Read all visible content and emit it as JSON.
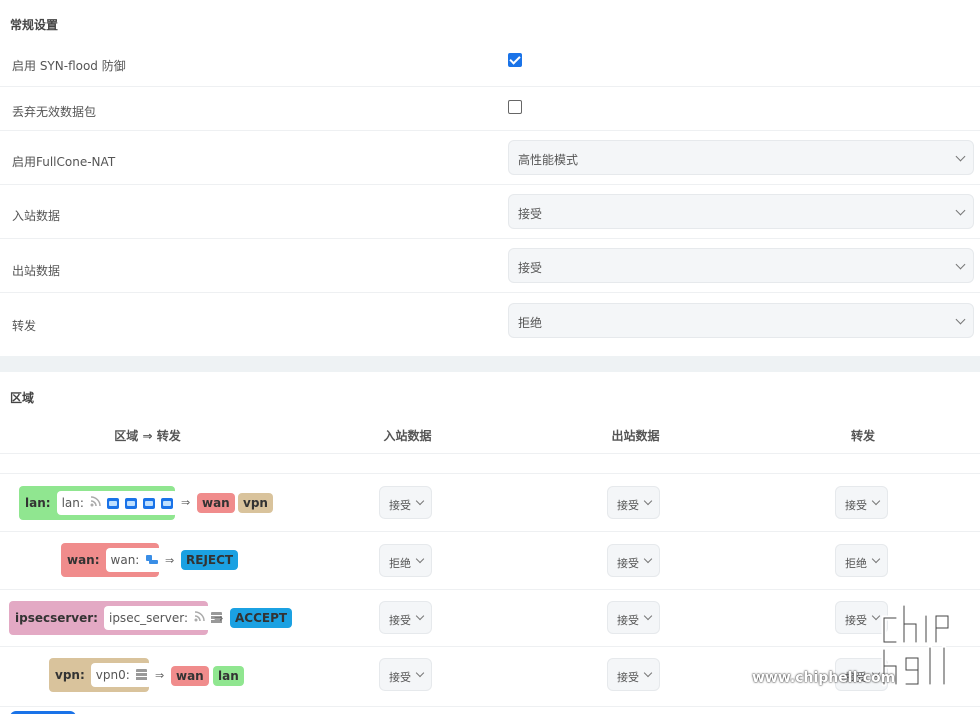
{
  "general": {
    "title": "常规设置",
    "rows": [
      {
        "label": "启用 SYN-flood 防御",
        "type": "checkbox",
        "checked": true
      },
      {
        "label": "丢弃无效数据包",
        "type": "checkbox",
        "checked": false
      },
      {
        "label": "启用FullCone-NAT",
        "type": "select",
        "value": "高性能模式"
      },
      {
        "label": "入站数据",
        "type": "select",
        "value": "接受"
      },
      {
        "label": "出站数据",
        "type": "select",
        "value": "接受"
      },
      {
        "label": "转发",
        "type": "select",
        "value": "拒绝"
      }
    ]
  },
  "zones": {
    "title": "区域",
    "headers": {
      "zone_forward": "区域 ⇒ 转发",
      "input": "入站数据",
      "output": "出站数据",
      "forward": "转发"
    },
    "arrow": "⇒",
    "rows": [
      {
        "name": "lan:",
        "network": "lan:",
        "icons": [
          "wifi-icon",
          "ethernet-port-icon",
          "ethernet-port-icon",
          "ethernet-port-icon",
          "ethernet-port-icon"
        ],
        "color": "#90e690",
        "targets": [
          {
            "label": "wan",
            "color": "#f08c8c"
          },
          {
            "label": "vpn",
            "color": "#d9c39c"
          }
        ],
        "input": "接受",
        "output": "接受",
        "forward": "接受"
      },
      {
        "name": "wan:",
        "network": "wan:",
        "icons": [
          "vpn-network-icon"
        ],
        "color": "#f08c8c",
        "targets": [
          {
            "label": "REJECT",
            "color": "#1ba1e2"
          }
        ],
        "input": "拒绝",
        "output": "接受",
        "forward": "拒绝"
      },
      {
        "name": "ipsecserver:",
        "network": "ipsec_server:",
        "icons": [
          "wifi-icon",
          "server-icon"
        ],
        "color": "#e3a9c4",
        "targets": [
          {
            "label": "ACCEPT",
            "color": "#1ba1e2"
          }
        ],
        "input": "接受",
        "output": "接受",
        "forward": "接受"
      },
      {
        "name": "vpn:",
        "network": "vpn0:",
        "icons": [
          "server-icon"
        ],
        "color": "#d9c39c",
        "targets": [
          {
            "label": "wan",
            "color": "#f08c8c"
          },
          {
            "label": "lan",
            "color": "#90e690"
          }
        ],
        "input": "接受",
        "output": "接受",
        "forward": "接受"
      }
    ]
  },
  "watermark": {
    "text": "www.chiphell.com",
    "logo_text": "chip hell"
  }
}
